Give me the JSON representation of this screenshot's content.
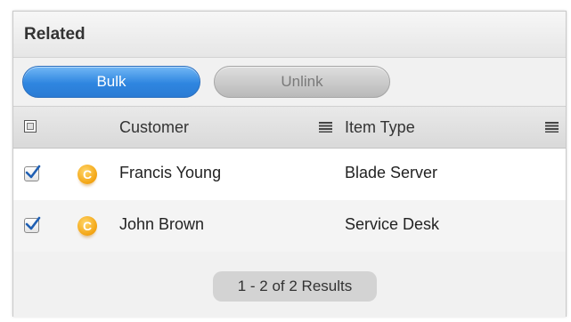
{
  "panel": {
    "title": "Related"
  },
  "toolbar": {
    "bulk_label": "Bulk",
    "unlink_label": "Unlink"
  },
  "table": {
    "columns": [
      "Customer",
      "Item Type"
    ],
    "rows": [
      {
        "checked": true,
        "badge": "C",
        "customer": "Francis Young",
        "item_type": "Blade Server"
      },
      {
        "checked": true,
        "badge": "C",
        "customer": "John Brown",
        "item_type": "Service Desk"
      }
    ]
  },
  "pager": {
    "text": "1 - 2 of 2 Results"
  },
  "colors": {
    "bulk_button": "#2f86e0",
    "badge": "#f3a412",
    "check": "#1f5fb3"
  },
  "icons": [
    "select-all-checkbox-icon",
    "column-menu-icon",
    "checkbox-checked-icon",
    "customer-badge-icon"
  ]
}
